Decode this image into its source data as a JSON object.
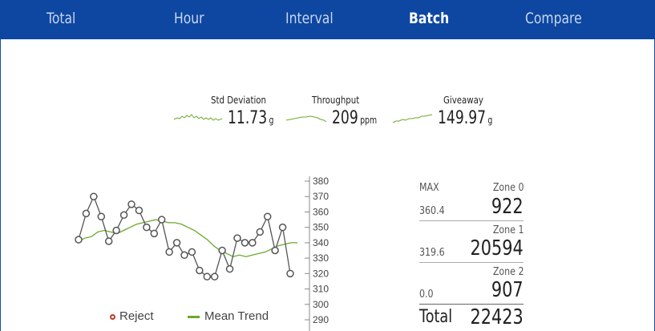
{
  "tabs": [
    {
      "label": "Total",
      "active": false
    },
    {
      "label": "Hour",
      "active": false
    },
    {
      "label": "Interval",
      "active": false
    },
    {
      "label": "Batch",
      "active": true
    },
    {
      "label": "Compare",
      "active": false
    }
  ],
  "kpis": [
    {
      "label": "Std Deviation",
      "value": "11.73",
      "unit": "g"
    },
    {
      "label": "Throughput",
      "value": "209",
      "unit": "ppm"
    },
    {
      "label": "Giveaway",
      "value": "149.97",
      "unit": "g"
    }
  ],
  "legend": {
    "reject": "Reject",
    "mean_trend": "Mean Trend"
  },
  "zones": {
    "max_label": "MAX",
    "rows": [
      {
        "name": "Zone 0",
        "limit": "360.4",
        "count": "922"
      },
      {
        "name": "Zone 1",
        "limit": "319.6",
        "count": "20594"
      },
      {
        "name": "Zone 2",
        "limit": "0.0",
        "count": "907"
      }
    ],
    "total_label": "Total",
    "total": "22423"
  },
  "colors": {
    "tabbar": "#0d47a1",
    "trend": "#6aaa2a",
    "reject": "#c0392b",
    "points": "#555555"
  },
  "chart_data": {
    "type": "line",
    "y_ticks": [
      "380",
      "370",
      "360",
      "350",
      "340",
      "330",
      "320",
      "310",
      "300",
      "290"
    ],
    "ylim": [
      290,
      380
    ],
    "series": [
      {
        "name": "Reject",
        "values": [
          342,
          359,
          370,
          357,
          341,
          348,
          358,
          365,
          361,
          350,
          346,
          355,
          334,
          340,
          332,
          334,
          322,
          318,
          318,
          335,
          323,
          343,
          340,
          340,
          347,
          357,
          335,
          350,
          320
        ]
      },
      {
        "name": "Mean Trend",
        "values": [
          341,
          343,
          344,
          347,
          348,
          347,
          346,
          348,
          350,
          352,
          353,
          354,
          355,
          354,
          353,
          353,
          352,
          350,
          348,
          345,
          342,
          338,
          335,
          333,
          331,
          332,
          331,
          332,
          333,
          334,
          336,
          338,
          339,
          340,
          340
        ]
      }
    ]
  }
}
